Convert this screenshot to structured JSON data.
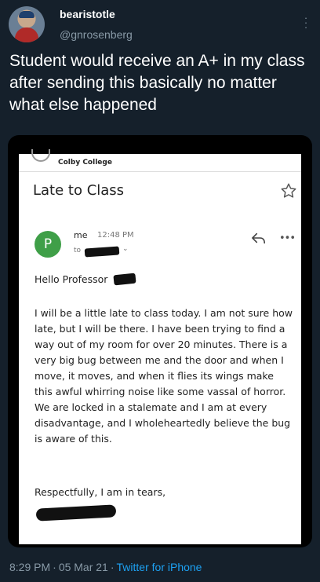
{
  "tweet": {
    "display_name": "bearistotle",
    "handle": "@gnrosenberg",
    "text": "Student would receive an A+ in my class after sending this basically no matter what else happened",
    "time": "8:29 PM",
    "separator": "·",
    "date": "05 Mar 21",
    "source": "Twitter for iPhone"
  },
  "email": {
    "college": "Colby College",
    "subject": "Late to Class",
    "sender_initial": "P",
    "sender_name": "me",
    "sent_time": "12:48 PM",
    "to_label": "to",
    "greeting": "Hello Professor",
    "body": "I will be a little late to class today. I am not sure how late, but I will be there. I have been trying to find a way out of my room for over 20 minutes. There is a very big bug between me and the door and when I move, it moves, and when it flies its wings make this awful whirring noise like some vassal of horror. We are locked in a stalemate and I am at every disadvantage, and I wholeheartedly believe the bug is aware of this.",
    "signoff": "Respectfully, I am in tears,"
  },
  "colors": {
    "background": "#15202b",
    "secondary_text": "#8899a6",
    "link": "#1da1f2",
    "sender_avatar": "#3f9f48"
  }
}
